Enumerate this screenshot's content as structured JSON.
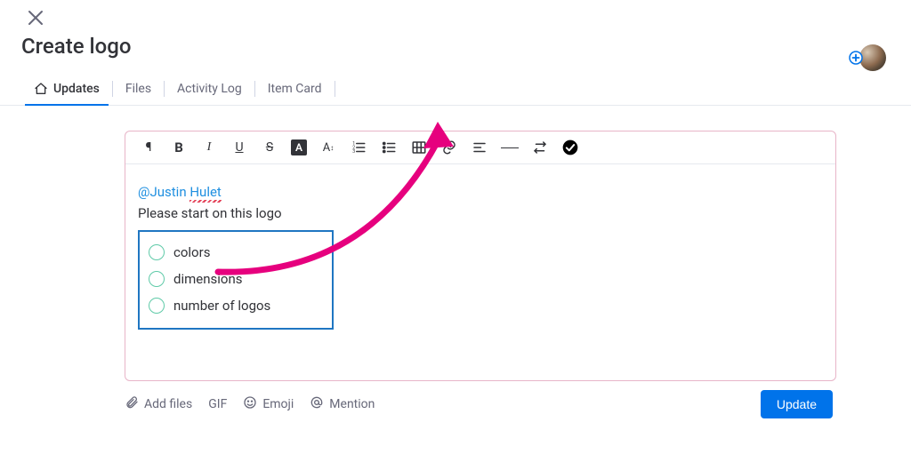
{
  "header": {
    "title": "Create logo"
  },
  "tabs": [
    {
      "label": "Updates",
      "active": true
    },
    {
      "label": "Files",
      "active": false
    },
    {
      "label": "Activity Log",
      "active": false
    },
    {
      "label": "Item Card",
      "active": false
    }
  ],
  "editor": {
    "mention_prefix": "@",
    "mention_first": "Justin",
    "mention_last": "Hulet",
    "body_line": "Please start on this logo",
    "checklist": [
      {
        "text": "colors"
      },
      {
        "text": "dimensions"
      },
      {
        "text": "number of logos"
      }
    ]
  },
  "footer": {
    "add_files": "Add files",
    "gif": "GIF",
    "emoji": "Emoji",
    "mention": "Mention",
    "update": "Update"
  },
  "toolbar_icons": [
    "paragraph-icon",
    "bold-icon",
    "italic-icon",
    "underline-icon",
    "strike-icon",
    "text-bg-icon",
    "font-size-icon",
    "ordered-list-icon",
    "unordered-list-icon",
    "table-icon",
    "link-icon",
    "align-icon",
    "hr-icon",
    "swap-icon",
    "checklist-icon"
  ],
  "colors": {
    "accent": "#0073ea",
    "arrow": "#e6007e",
    "checklist_border": "#1f76c2"
  }
}
